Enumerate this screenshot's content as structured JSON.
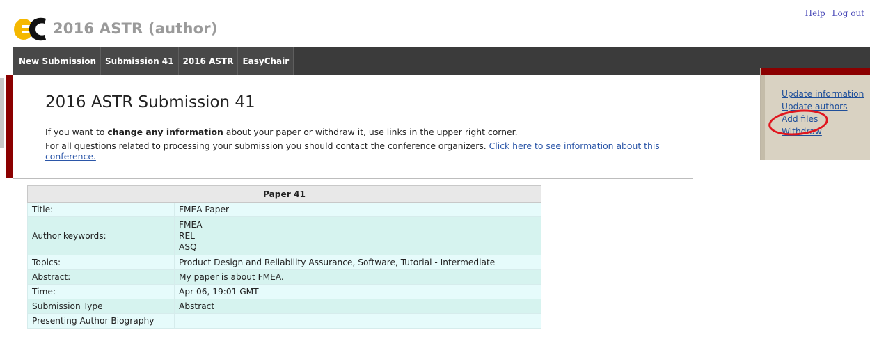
{
  "app": {
    "title": "2016 ASTR (author)",
    "logo_colors": {
      "primary": "#f5b800",
      "secondary": "#111111"
    }
  },
  "toplinks": {
    "help": "Help",
    "logout": "Log out"
  },
  "nav": {
    "tabs": [
      {
        "label": "New Submission"
      },
      {
        "label": "Submission 41"
      },
      {
        "label": "2016 ASTR"
      },
      {
        "label": "EasyChair"
      }
    ]
  },
  "page": {
    "title": "2016 ASTR Submission 41",
    "info1_before": "If you want to ",
    "info1_bold": "change any information",
    "info1_after": " about your paper or withdraw it, use links in the upper right corner.",
    "info2_before": "For all questions related to processing your submission you should contact the conference organizers. ",
    "info2_link": "Click here to see information about this conference."
  },
  "side_panel": {
    "links": [
      {
        "label": "Update information"
      },
      {
        "label": "Update authors"
      },
      {
        "label": "Add files"
      },
      {
        "label": "Withdraw"
      }
    ],
    "highlight_color": "#e0161e"
  },
  "paper": {
    "header": "Paper 41",
    "rows": [
      {
        "label": "Title:",
        "value": "FMEA Paper"
      },
      {
        "label": "Author keywords:",
        "keywords": [
          "FMEA",
          "REL",
          "ASQ"
        ]
      },
      {
        "label": "Topics:",
        "value": "Product Design and Reliability Assurance, Software, Tutorial - Intermediate"
      },
      {
        "label": "Abstract:",
        "value": "My paper is about FMEA."
      },
      {
        "label": "Time:",
        "value": "Apr 06, 19:01 GMT"
      },
      {
        "label": "Submission Type",
        "value": "Abstract"
      },
      {
        "label": "Presenting Author Biography",
        "value": ""
      }
    ]
  }
}
